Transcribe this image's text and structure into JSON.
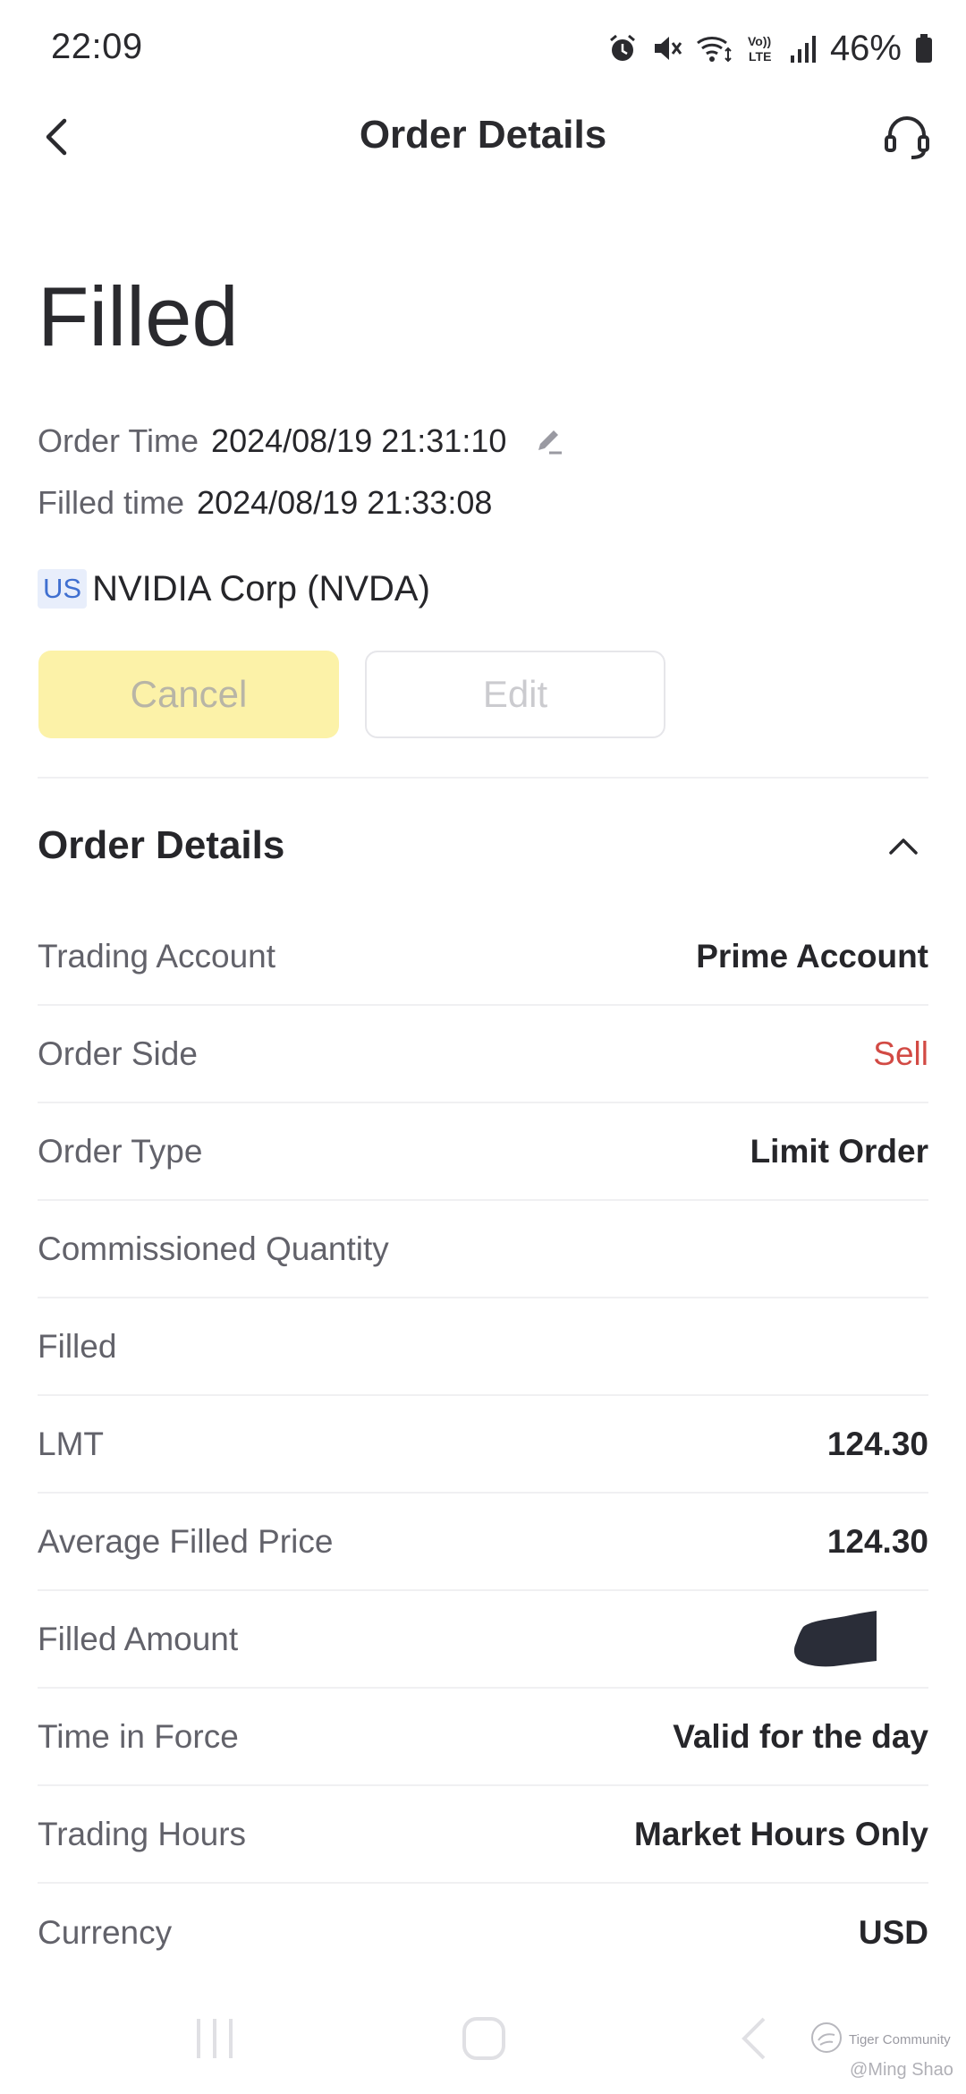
{
  "status_bar": {
    "time": "22:09",
    "battery_percent": "46%",
    "icons": [
      "alarm-icon",
      "mute-icon",
      "wifi-icon",
      "volte-icon",
      "signal-icon",
      "battery-icon"
    ]
  },
  "nav": {
    "title": "Order Details",
    "back_icon": "chevron-left-icon",
    "support_icon": "headset-icon"
  },
  "order": {
    "status": "Filled",
    "order_time_label": "Order Time",
    "order_time": "2024/08/19 21:31:10",
    "filled_time_label": "Filled time",
    "filled_time": "2024/08/19 21:33:08",
    "market_badge": "US",
    "symbol": "NVIDIA Corp (NVDA)"
  },
  "actions": {
    "cancel_label": "Cancel",
    "edit_label": "Edit"
  },
  "details": {
    "section_title": "Order Details",
    "rows": [
      {
        "label": "Trading Account",
        "value": "Prime Account"
      },
      {
        "label": "Order Side",
        "value": "Sell"
      },
      {
        "label": "Order Type",
        "value": "Limit Order"
      },
      {
        "label": "Commissioned Quantity",
        "value": ""
      },
      {
        "label": "Filled",
        "value": ""
      },
      {
        "label": "LMT",
        "value": "124.30"
      },
      {
        "label": "Average Filled Price",
        "value": "124.30"
      },
      {
        "label": "Filled Amount",
        "value": ""
      },
      {
        "label": "Time in Force",
        "value": "Valid for the day"
      },
      {
        "label": "Trading Hours",
        "value": "Market Hours Only"
      },
      {
        "label": "Currency",
        "value": "USD"
      }
    ]
  },
  "colors": {
    "sell": "#d24a44",
    "cancel_bg": "#fcf2a8",
    "badge_bg": "#e8eefb",
    "badge_text": "#3f6fd0"
  },
  "watermark": {
    "brand": "Tiger Community",
    "user": "@Ming Shao"
  }
}
